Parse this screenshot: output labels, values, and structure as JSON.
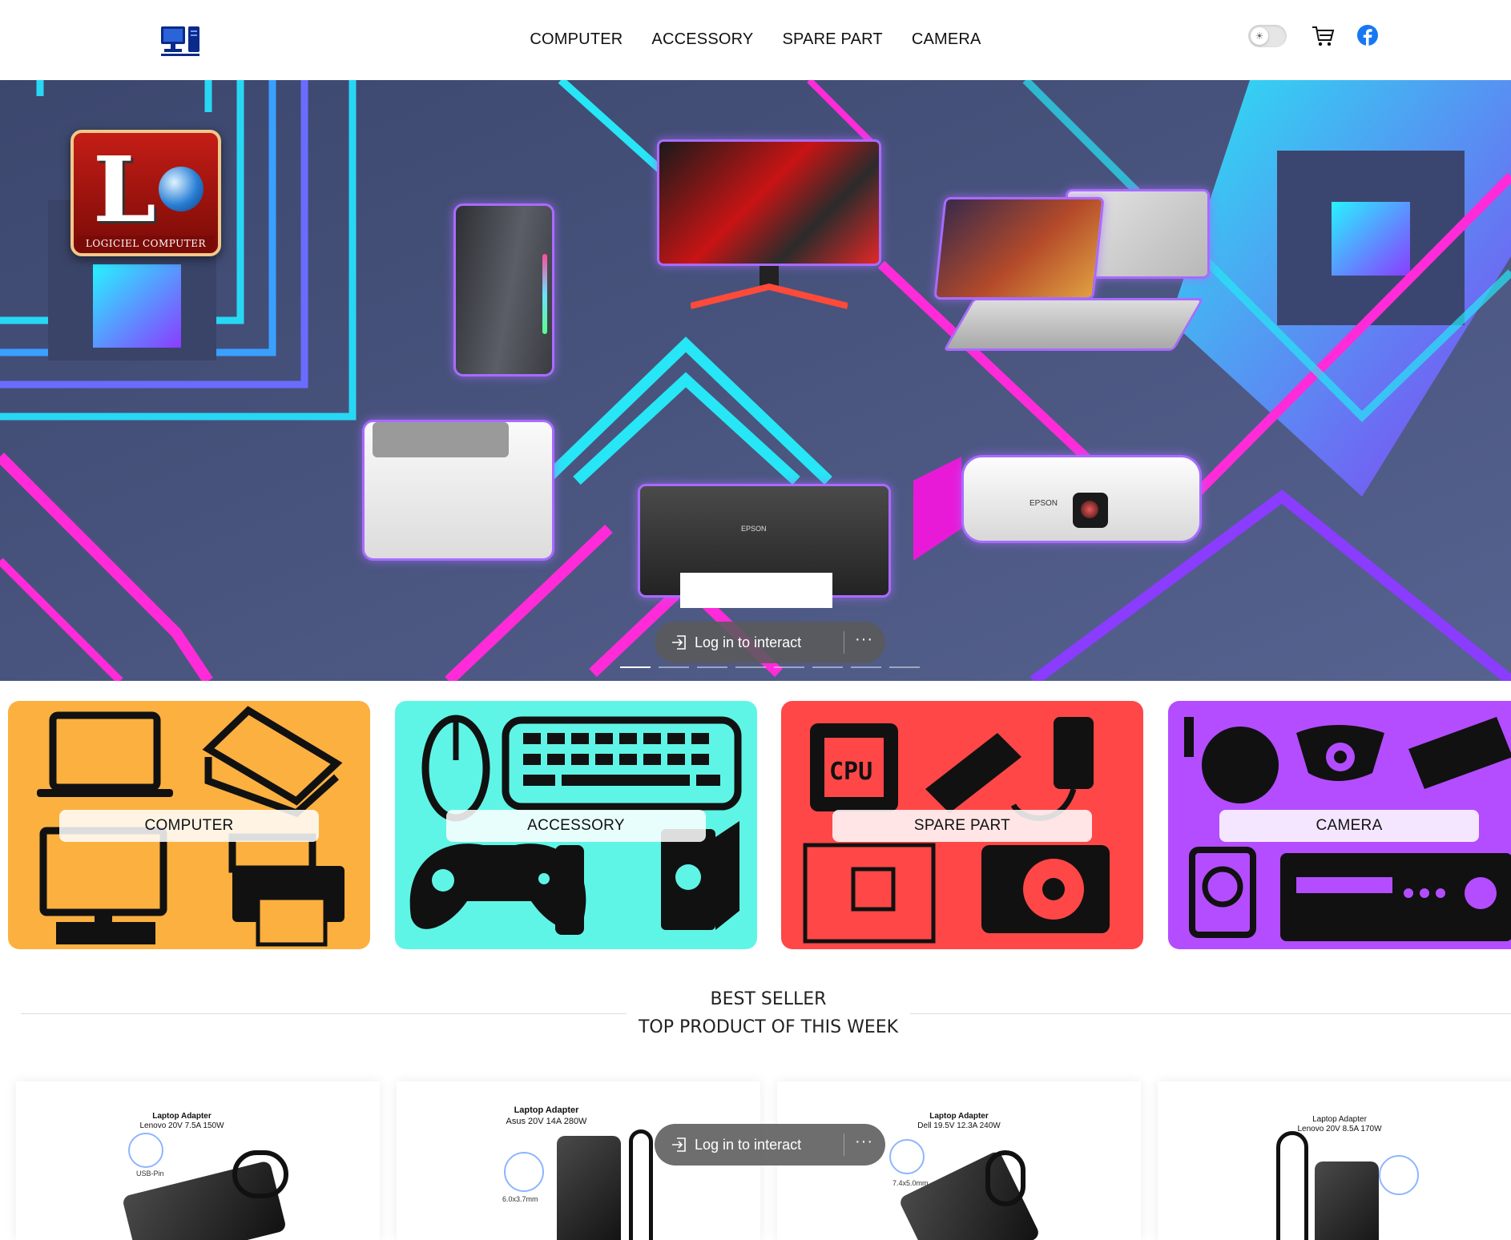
{
  "nav": {
    "items": [
      "COMPUTER",
      "ACCESSORY",
      "SPARE PART",
      "CAMERA"
    ]
  },
  "header": {
    "logo_icon": "computer-desk-icon",
    "theme_toggle_icon": "sun-icon",
    "cart_icon": "cart-icon",
    "facebook_icon": "facebook-icon"
  },
  "hero": {
    "brand_caption": "LOGICIEL COMPUTER",
    "printer_label": "EPSON",
    "projector_label": "EPSON",
    "slide_count": 8,
    "active_slide": 1
  },
  "interact": {
    "label": "Log in to interact",
    "more": "···"
  },
  "categories": [
    {
      "label": "COMPUTER",
      "color": "#fbb040"
    },
    {
      "label": "ACCESSORY",
      "color": "#5ff5e6"
    },
    {
      "label": "SPARE PART",
      "color": "#ff4747"
    },
    {
      "label": "CAMERA",
      "color": "#b34dff"
    }
  ],
  "best_seller": {
    "heading": "BEST SELLER",
    "subheading": "TOP PRODUCT OF THIS WEEK"
  },
  "products": [
    {
      "title": "Laptop Adapter",
      "spec": "Lenovo 20V 7.5A 150W",
      "tip": "USB-Pin"
    },
    {
      "title": "Laptop Adapter",
      "spec": "Asus 20V 14A 280W",
      "tip": "6.0x3.7mm"
    },
    {
      "title": "Laptop Adapter",
      "spec": "Dell 19.5V 12.3A 240W",
      "tip": "7.4x5.0mm"
    },
    {
      "title": "Laptop Adapter",
      "spec": "Lenovo 20V 8.5A 170W",
      "tip": ""
    }
  ],
  "colors": {
    "accent": "#a86bff",
    "cyan": "#27e6f5",
    "magenta": "#e81ad8",
    "hero_bg": "#4c5a85"
  }
}
